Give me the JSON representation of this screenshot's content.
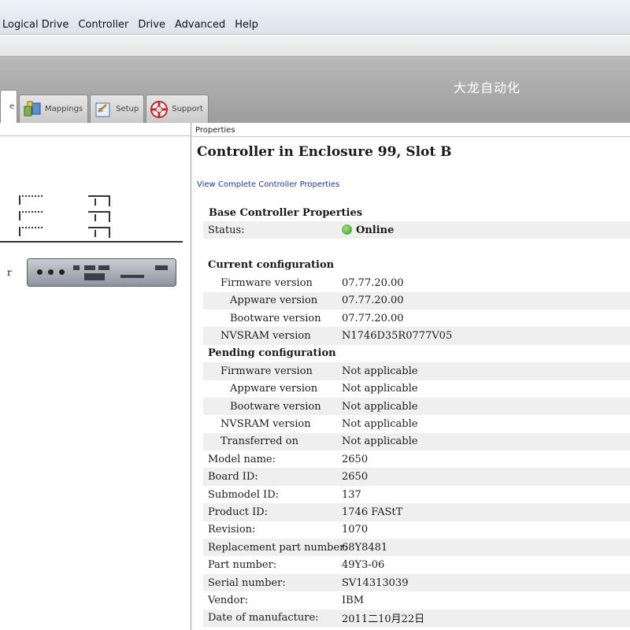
{
  "menu": [
    "Logical Drive",
    "Controller",
    "Drive",
    "Advanced",
    "Help"
  ],
  "watermark": "大龙自动化",
  "tabs": [
    {
      "label": "",
      "icon": "summary-icon",
      "active": true
    },
    {
      "label": "Mappings",
      "icon": "mappings-icon"
    },
    {
      "label": "Setup",
      "icon": "setup-icon"
    },
    {
      "label": "Support",
      "icon": "support-lifebuoy-icon"
    }
  ],
  "left": {
    "enclosure_label": "r"
  },
  "right": {
    "pane_header": "Properties",
    "title": "Controller in Enclosure 99, Slot B",
    "link": "View Complete Controller Properties",
    "section": "Base Controller Properties",
    "rows": [
      {
        "label": "Status:",
        "value": "Online",
        "indent": 0,
        "status": true
      },
      {
        "label": "",
        "value": "",
        "indent": 0
      },
      {
        "label": "Current configuration",
        "value": "",
        "indent": 0,
        "group": true
      },
      {
        "label": "Firmware version",
        "value": "07.77.20.00",
        "indent": 1
      },
      {
        "label": "Appware version",
        "value": "07.77.20.00",
        "indent": 2
      },
      {
        "label": "Bootware version",
        "value": "07.77.20.00",
        "indent": 2
      },
      {
        "label": "NVSRAM version",
        "value": "N1746D35R0777V05",
        "indent": 1
      },
      {
        "label": "Pending configuration",
        "value": "",
        "indent": 0,
        "group": true
      },
      {
        "label": "Firmware version",
        "value": "Not applicable",
        "indent": 1
      },
      {
        "label": "Appware version",
        "value": "Not applicable",
        "indent": 2
      },
      {
        "label": "Bootware version",
        "value": "Not applicable",
        "indent": 2
      },
      {
        "label": "NVSRAM version",
        "value": "Not applicable",
        "indent": 1
      },
      {
        "label": "Transferred on",
        "value": "Not applicable",
        "indent": 1
      },
      {
        "label": "Model name:",
        "value": "2650",
        "indent": 0
      },
      {
        "label": "Board ID:",
        "value": "2650",
        "indent": 0
      },
      {
        "label": "Submodel ID:",
        "value": "137",
        "indent": 0
      },
      {
        "label": "Product ID:",
        "value": "1746 FAStT",
        "indent": 0
      },
      {
        "label": "Revision:",
        "value": "1070",
        "indent": 0
      },
      {
        "label": "Replacement part number:",
        "value": "68Y8481",
        "indent": 0
      },
      {
        "label": "Part number:",
        "value": "49Y3-06",
        "indent": 0
      },
      {
        "label": "Serial number:",
        "value": "SV14313039",
        "indent": 0
      },
      {
        "label": "Vendor:",
        "value": "IBM",
        "indent": 0
      },
      {
        "label": "Date of manufacture:",
        "value": "2011二10月22日",
        "indent": 0
      }
    ]
  }
}
